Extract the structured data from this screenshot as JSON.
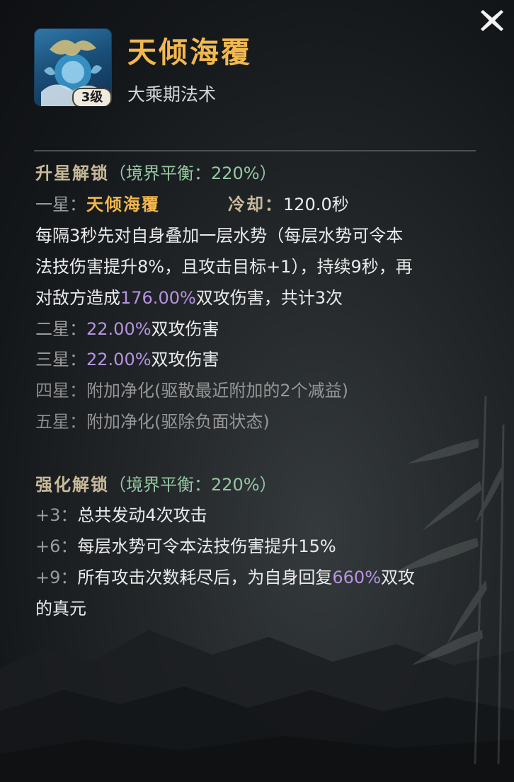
{
  "skill": {
    "name": "天倾海覆",
    "category": "大乘期法术",
    "level_badge": "3级",
    "icon_name": "water-dragon-skill-icon"
  },
  "close_icon": "close-icon",
  "colors": {
    "gold": "#f2b84e",
    "purple": "#b793e0",
    "green": "#95c8a0",
    "header": "#c8ba99"
  },
  "star_section": {
    "header": "升星解锁",
    "balance": "（境界平衡：220%）",
    "one_star_label": "一星：",
    "one_star_skill": "天倾海覆",
    "cooldown_label": "冷却：",
    "cooldown_value": "120.0秒",
    "desc_line1": "每隔3秒先对自身叠加一层水势（每层水势可令本",
    "desc_line2": "法技伤害提升8%，且攻击目标+1），持续9秒，再",
    "desc_line3_pre": "对敌方造成",
    "desc_line3_value": "176.00%",
    "desc_line3_post": "双攻伤害，共计3次",
    "two_star_label": "二星：",
    "two_star_value": "22.00%",
    "two_star_text": "双攻伤害",
    "three_star_label": "三星：",
    "three_star_value": "22.00%",
    "three_star_text": "双攻伤害",
    "four_star_label": "四星：",
    "four_star_text": "附加净化(驱散最近附加的2个减益)",
    "five_star_label": "五星：",
    "five_star_text": "附加净化(驱除负面状态)"
  },
  "enhance_section": {
    "header": "强化解锁",
    "balance": "（境界平衡：220%）",
    "plus3_label": "+3：",
    "plus3_text": "总共发动4次攻击",
    "plus6_label": "+6：",
    "plus6_text": "每层水势可令本法技伤害提升15%",
    "plus9_label": "+9：",
    "plus9_pre": "所有攻击次数耗尽后，为自身回复",
    "plus9_value": "660%",
    "plus9_post": "双攻",
    "plus9_line2": "的真元"
  }
}
